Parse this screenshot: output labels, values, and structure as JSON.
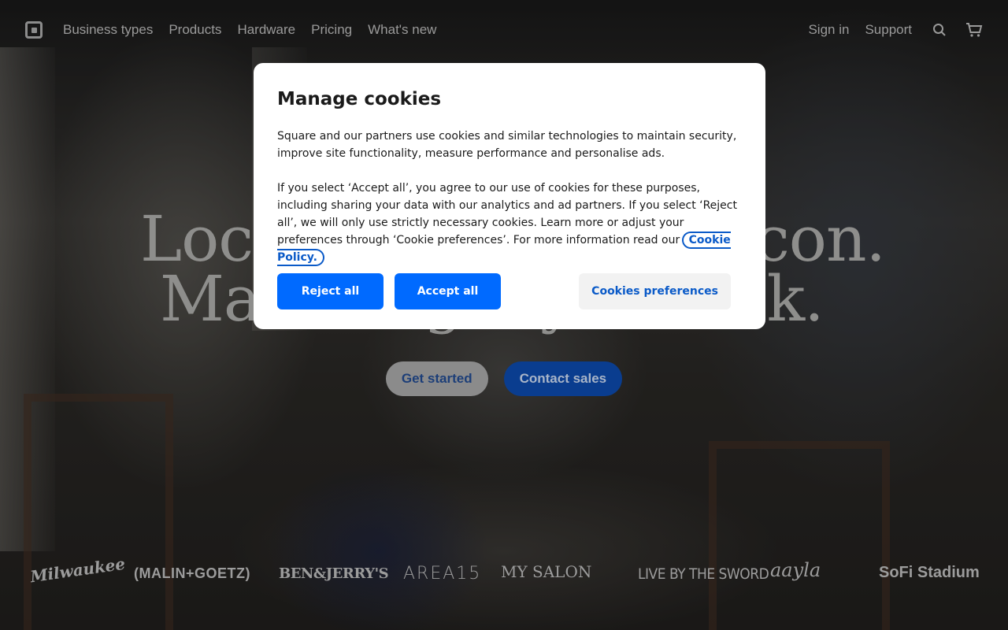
{
  "nav": {
    "items": [
      "Business types",
      "Products",
      "Hardware",
      "Pricing",
      "What's new"
    ],
    "sign_in": "Sign in",
    "support": "Support",
    "icons": [
      "square-logo-icon",
      "search-icon",
      "cart-icon"
    ]
  },
  "hero": {
    "title_line1": "Local icon.",
    "title_line2": "Making history on the block.",
    "visible_line1_left": "Loca",
    "visible_line1_right": "con.",
    "visible_line2_left": "Ma",
    "visible_line2_mid": "g",
    "visible_line2_mid2": "y",
    "visible_line2_right": "ck.",
    "get_started": "Get started",
    "contact_sales": "Contact sales"
  },
  "brands": [
    "Milwaukee",
    "(MALIN+GOETZ)",
    "BEN&JERRY'S",
    "AREA15",
    "MY SALON",
    "LIVE BY THE SWORD",
    "aayla",
    "SoFi Stadium"
  ],
  "cookie_modal": {
    "title": "Manage cookies",
    "paragraph1": "Square and our partners use cookies and similar technologies to maintain security, improve site functionality, measure performance and personalise ads.",
    "paragraph2": "If you select ‘Accept all’, you agree to our use of cookies for these purposes, including sharing your data with our analytics and ad partners. If you select ‘Reject all’, we will only use strictly necessary cookies. Learn more or adjust your preferences through ‘Cookie preferences’. For more information read our",
    "policy_link": "Cookie Policy.",
    "reject_all": "Reject all",
    "accept_all": "Accept all",
    "preferences": "Cookies preferences"
  },
  "colors": {
    "primary_blue": "#006aff",
    "link_blue": "#0a5ac8"
  }
}
